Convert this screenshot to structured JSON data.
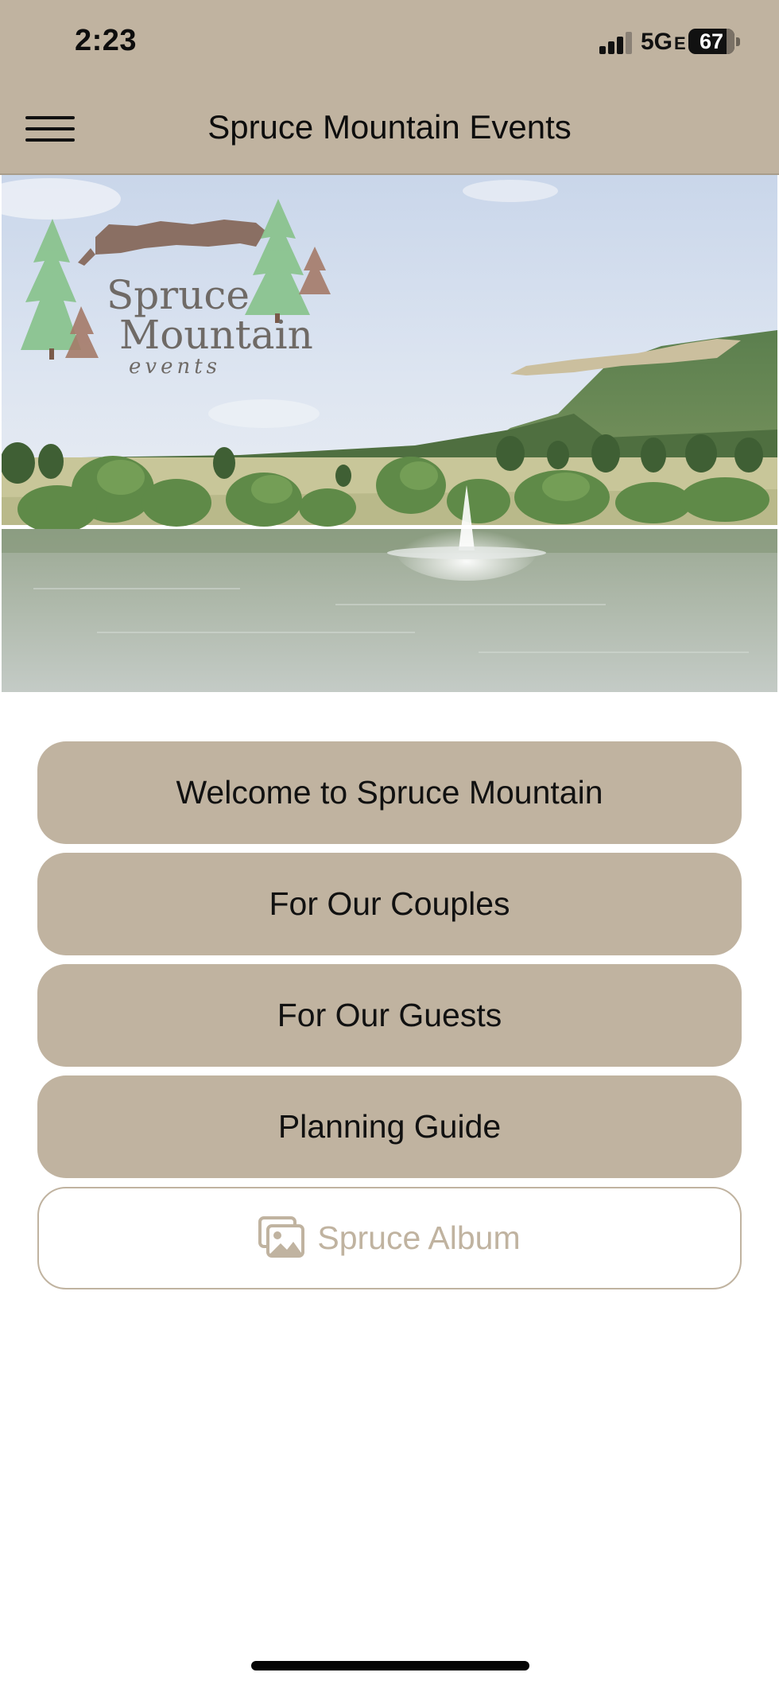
{
  "status_bar": {
    "time": "2:23",
    "network": "5G",
    "network_suffix": "E",
    "battery": "67"
  },
  "header": {
    "title": "Spruce Mountain Events",
    "menu_icon": "hamburger-icon"
  },
  "hero": {
    "logo_line1": "Spruce",
    "logo_line2": "Mountain",
    "logo_line3": "events"
  },
  "nav": {
    "items": [
      {
        "label": "Welcome to Spruce Mountain"
      },
      {
        "label": "For Our Couples"
      },
      {
        "label": "For Our Guests"
      },
      {
        "label": "Planning Guide"
      }
    ],
    "album": {
      "label": "Spruce Album",
      "icon": "photo-album-icon"
    }
  },
  "colors": {
    "accent": "#c0b3a0",
    "text": "#111111",
    "background": "#ffffff"
  }
}
